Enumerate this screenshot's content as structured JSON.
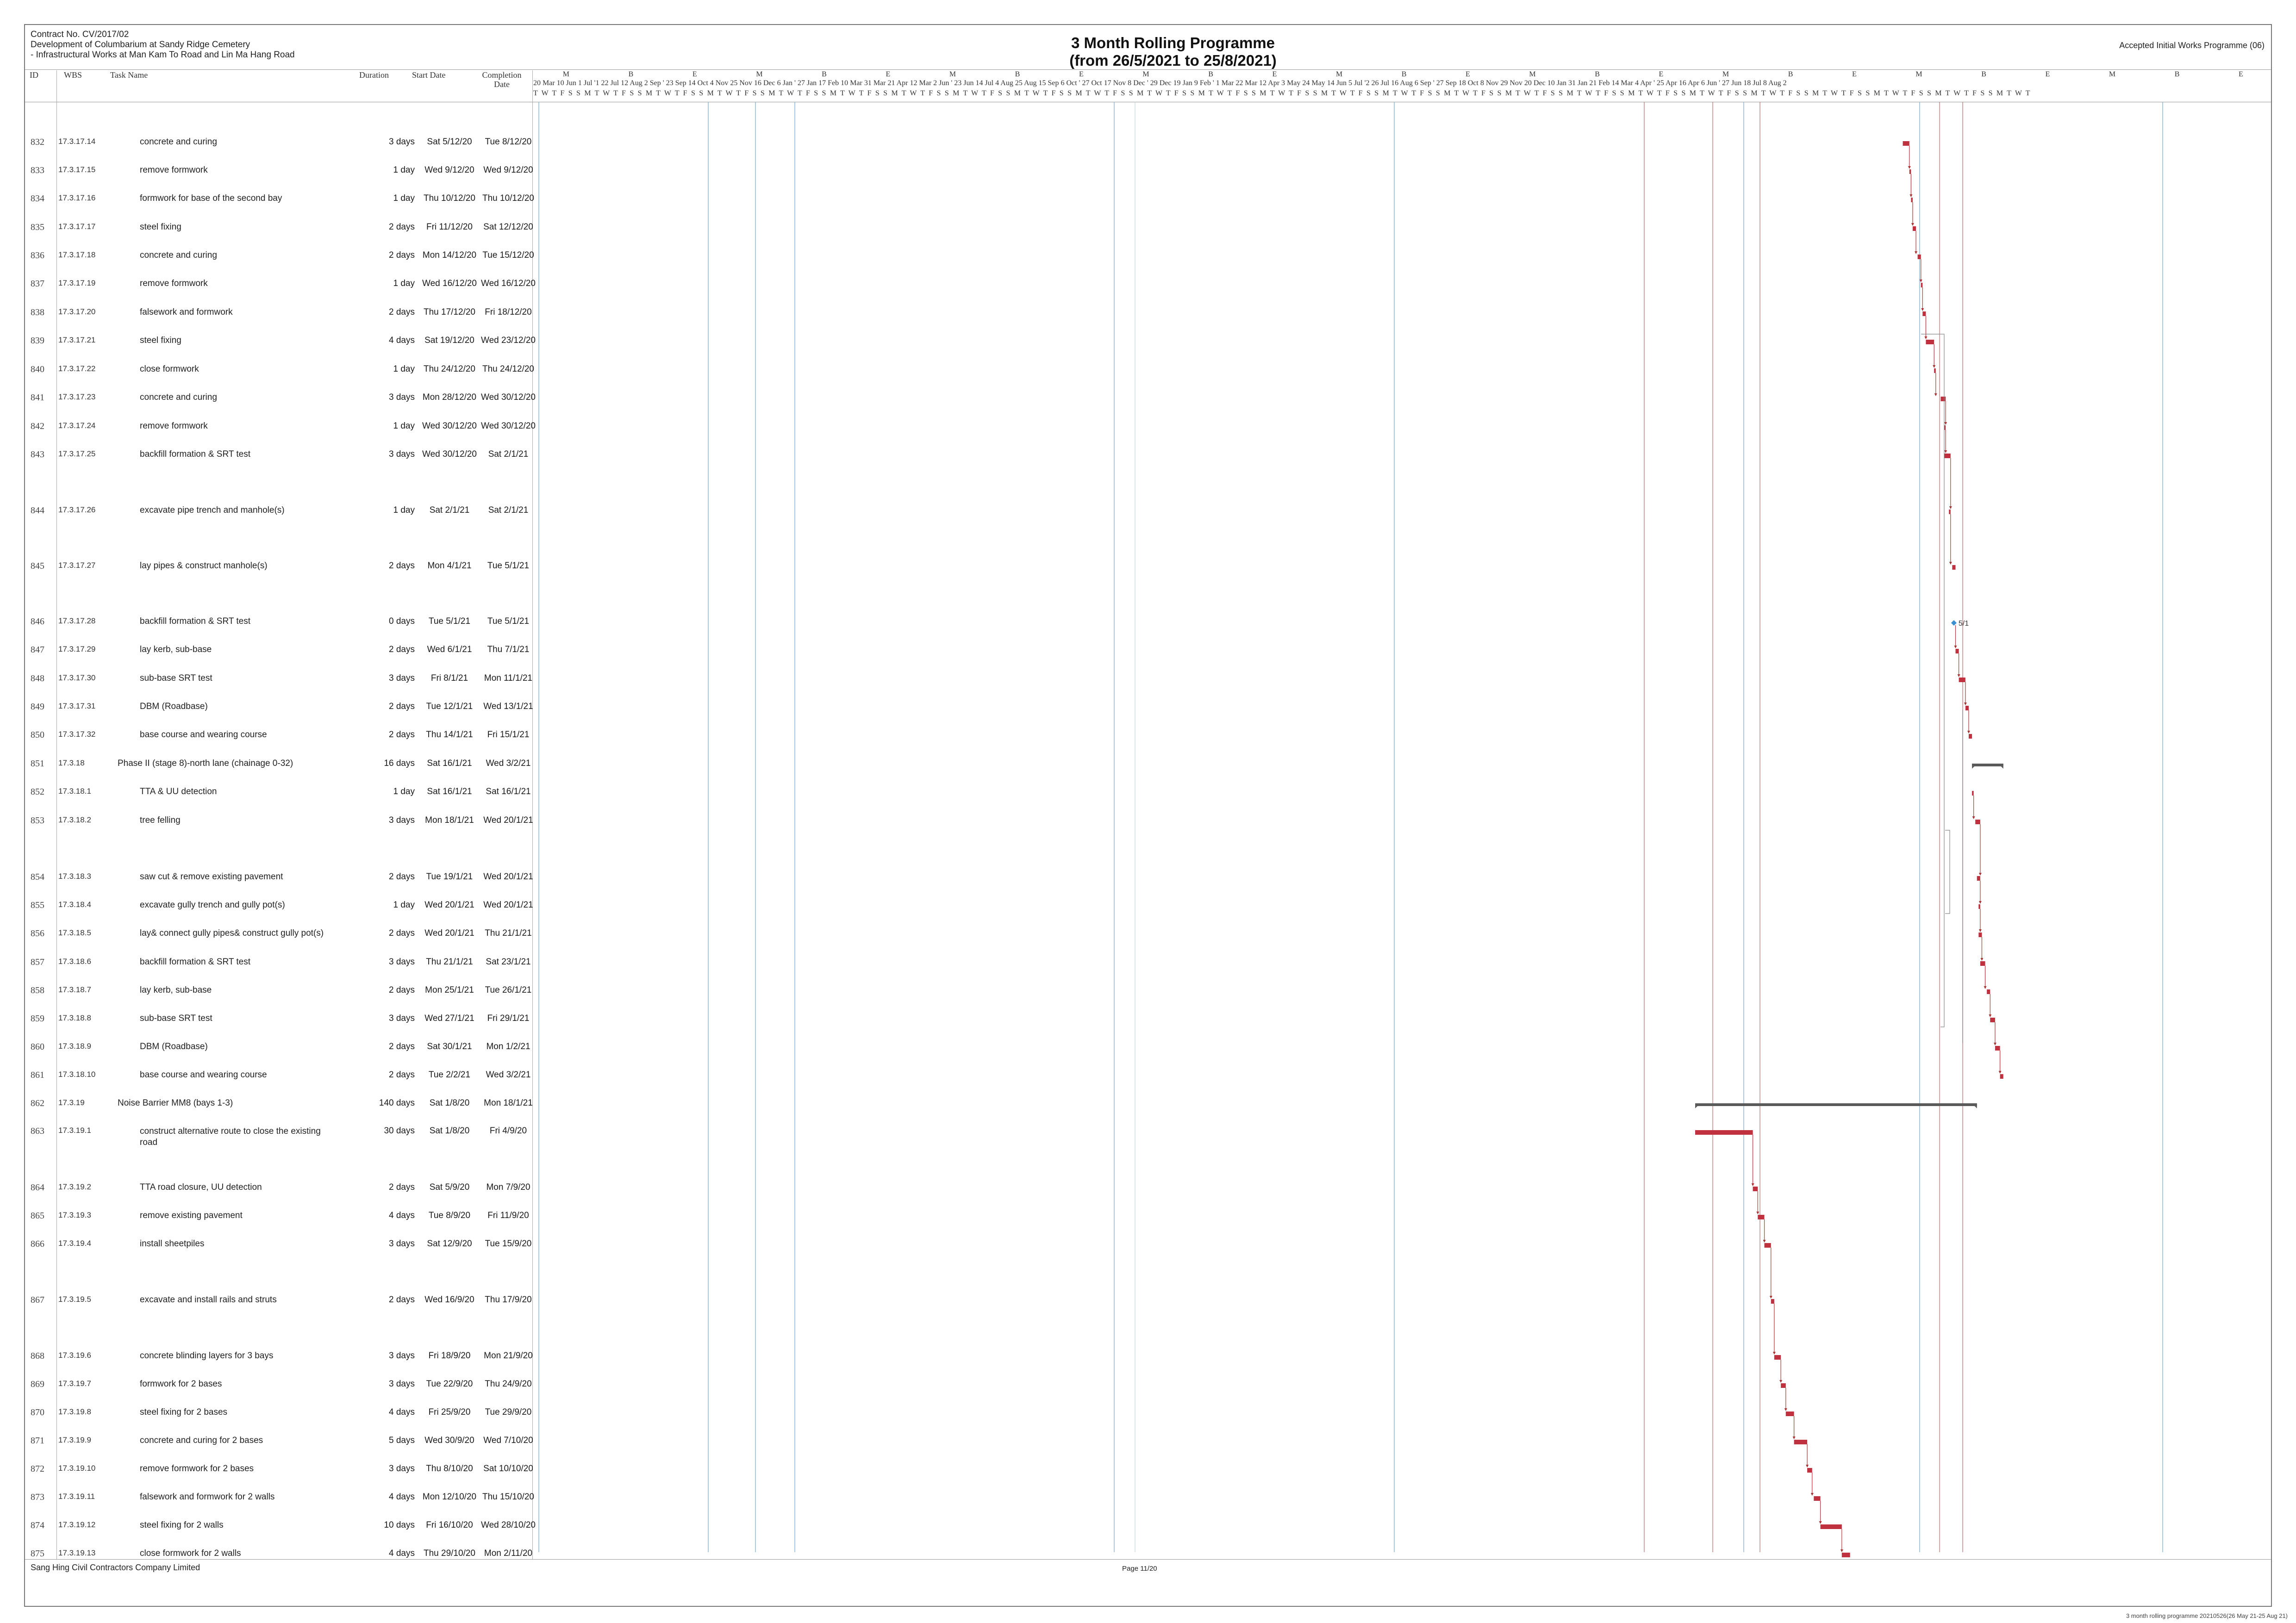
{
  "header": {
    "left_lines": [
      "Contract No. CV/2017/02",
      "Development of Columbarium at Sandy Ridge Cemetery",
      "- Infrastructural Works at Man Kam To Road and Lin Ma Hang Road"
    ],
    "title_line1": "3 Month Rolling Programme",
    "title_line2": "(from 26/5/2021 to 25/8/2021)",
    "right": "Accepted Initial Works Programme (06)"
  },
  "columns": {
    "id": "ID",
    "wbs": "WBS",
    "task": "Task Name",
    "duration": "Duration",
    "start": "Start Date",
    "completion_1": "Completion",
    "completion_2": "Date"
  },
  "timeline": {
    "period_letters": "M B E M B E M B E M B E M B E M B E M B E M B E M B E",
    "dates": "20 Mar 10 Jun 1 Jul '1 22 Jul 12 Aug 2 Sep ' 23 Sep 14 Oct 4 Nov 25 Nov 16 Dec 6 Jan ' 27 Jan 17 Feb 10 Mar 31 Mar 21 Apr 12 Mar 2 Jun ' 23 Jun 14 Jul 4 Aug 25 Aug 15 Sep 6 Oct ' 27 Oct 17 Nov 8 Dec ' 29 Dec 19 Jan 9 Feb ' 1 Mar 22 Mar 12 Apr 3 May 24 May 14 Jun 5 Jul '2 26 Jul 16 Aug 6 Sep ' 27 Sep 18 Oct 8 Nov 29 Nov 20 Dec 10 Jan 31 Jan 21 Feb 14 Mar 4 Apr ' 25 Apr 16 Apr 6 Jun ' 27 Jun 18 Jul 8 Aug 2",
    "days": "T W T F S S M T W T F S S M T W T F S S M T W T F S S M T W T F S S M T W T F S S M T W T F S S M T W T F S S M T W T F S S M T W T F S S M T W T F S S M T W T F S S M T W T F S S M T W T F S S M T W T F S S M T W T F S S M T W T F S S M T W T F S S M T W T F S S M T W T F S S M T W T F S S M T W T F S S M T W T F S S M T W T F S S M T W T"
  },
  "tasks": [
    {
      "id": "832",
      "wbs": "17.3.17.14",
      "name": "concrete and curing",
      "duration": "3 days",
      "start": "Sat 5/12/20",
      "end": "Tue 8/12/20"
    },
    {
      "id": "833",
      "wbs": "17.3.17.15",
      "name": "remove formwork",
      "duration": "1 day",
      "start": "Wed 9/12/20",
      "end": "Wed 9/12/20"
    },
    {
      "id": "834",
      "wbs": "17.3.17.16",
      "name": "formwork for base of the second bay",
      "duration": "1 day",
      "start": "Thu 10/12/20",
      "end": "Thu 10/12/20"
    },
    {
      "id": "835",
      "wbs": "17.3.17.17",
      "name": "steel fixing",
      "duration": "2 days",
      "start": "Fri 11/12/20",
      "end": "Sat 12/12/20"
    },
    {
      "id": "836",
      "wbs": "17.3.17.18",
      "name": "concrete and curing",
      "duration": "2 days",
      "start": "Mon 14/12/20",
      "end": "Tue 15/12/20"
    },
    {
      "id": "837",
      "wbs": "17.3.17.19",
      "name": "remove formwork",
      "duration": "1 day",
      "start": "Wed 16/12/20",
      "end": "Wed 16/12/20"
    },
    {
      "id": "838",
      "wbs": "17.3.17.20",
      "name": "falsework and formwork",
      "duration": "2 days",
      "start": "Thu 17/12/20",
      "end": "Fri 18/12/20"
    },
    {
      "id": "839",
      "wbs": "17.3.17.21",
      "name": "steel fixing",
      "duration": "4 days",
      "start": "Sat 19/12/20",
      "end": "Wed 23/12/20"
    },
    {
      "id": "840",
      "wbs": "17.3.17.22",
      "name": "close formwork",
      "duration": "1 day",
      "start": "Thu 24/12/20",
      "end": "Thu 24/12/20"
    },
    {
      "id": "841",
      "wbs": "17.3.17.23",
      "name": "concrete and curing",
      "duration": "3 days",
      "start": "Mon 28/12/20",
      "end": "Wed 30/12/20"
    },
    {
      "id": "842",
      "wbs": "17.3.17.24",
      "name": "remove formwork",
      "duration": "1 day",
      "start": "Wed 30/12/20",
      "end": "Wed 30/12/20"
    },
    {
      "id": "843",
      "wbs": "17.3.17.25",
      "name": "backfill formation & SRT test",
      "duration": "3 days",
      "start": "Wed 30/12/20",
      "end": "Sat 2/1/21"
    },
    {
      "id": "844",
      "wbs": "17.3.17.26",
      "name": "excavate pipe trench and manhole(s)",
      "duration": "1 day",
      "start": "Sat 2/1/21",
      "end": "Sat 2/1/21"
    },
    {
      "id": "845",
      "wbs": "17.3.17.27",
      "name": "lay pipes & construct manhole(s)",
      "duration": "2 days",
      "start": "Mon 4/1/21",
      "end": "Tue 5/1/21"
    },
    {
      "id": "846",
      "wbs": "17.3.17.28",
      "name": "backfill formation & SRT test",
      "duration": "0 days",
      "start": "Tue 5/1/21",
      "end": "Tue 5/1/21"
    },
    {
      "id": "847",
      "wbs": "17.3.17.29",
      "name": "lay kerb, sub-base",
      "duration": "2 days",
      "start": "Wed 6/1/21",
      "end": "Thu 7/1/21"
    },
    {
      "id": "848",
      "wbs": "17.3.17.30",
      "name": "sub-base SRT test",
      "duration": "3 days",
      "start": "Fri 8/1/21",
      "end": "Mon 11/1/21"
    },
    {
      "id": "849",
      "wbs": "17.3.17.31",
      "name": "DBM (Roadbase)",
      "duration": "2 days",
      "start": "Tue 12/1/21",
      "end": "Wed 13/1/21"
    },
    {
      "id": "850",
      "wbs": "17.3.17.32",
      "name": "base course and wearing course",
      "duration": "2 days",
      "start": "Thu 14/1/21",
      "end": "Fri 15/1/21"
    },
    {
      "id": "851",
      "wbs": "17.3.18",
      "name": "Phase II (stage 8)-north lane (chainage 0-32)",
      "duration": "16 days",
      "start": "Sat 16/1/21",
      "end": "Wed 3/2/21"
    },
    {
      "id": "852",
      "wbs": "17.3.18.1",
      "name": "TTA & UU detection",
      "duration": "1 day",
      "start": "Sat 16/1/21",
      "end": "Sat 16/1/21"
    },
    {
      "id": "853",
      "wbs": "17.3.18.2",
      "name": "tree felling",
      "duration": "3 days",
      "start": "Mon 18/1/21",
      "end": "Wed 20/1/21"
    },
    {
      "id": "854",
      "wbs": "17.3.18.3",
      "name": "saw cut & remove existing pavement",
      "duration": "2 days",
      "start": "Tue 19/1/21",
      "end": "Wed 20/1/21"
    },
    {
      "id": "855",
      "wbs": "17.3.18.4",
      "name": "excavate gully trench and gully pot(s)",
      "duration": "1 day",
      "start": "Wed 20/1/21",
      "end": "Wed 20/1/21"
    },
    {
      "id": "856",
      "wbs": "17.3.18.5",
      "name": "lay& connect gully pipes& construct gully pot(s)",
      "duration": "2 days",
      "start": "Wed 20/1/21",
      "end": "Thu 21/1/21"
    },
    {
      "id": "857",
      "wbs": "17.3.18.6",
      "name": "backfill formation & SRT test",
      "duration": "3 days",
      "start": "Thu 21/1/21",
      "end": "Sat 23/1/21"
    },
    {
      "id": "858",
      "wbs": "17.3.18.7",
      "name": "lay kerb, sub-base",
      "duration": "2 days",
      "start": "Mon 25/1/21",
      "end": "Tue 26/1/21"
    },
    {
      "id": "859",
      "wbs": "17.3.18.8",
      "name": "sub-base SRT test",
      "duration": "3 days",
      "start": "Wed 27/1/21",
      "end": "Fri 29/1/21"
    },
    {
      "id": "860",
      "wbs": "17.3.18.9",
      "name": "DBM (Roadbase)",
      "duration": "2 days",
      "start": "Sat 30/1/21",
      "end": "Mon 1/2/21"
    },
    {
      "id": "861",
      "wbs": "17.3.18.10",
      "name": "base course and wearing course",
      "duration": "2 days",
      "start": "Tue 2/2/21",
      "end": "Wed 3/2/21"
    },
    {
      "id": "862",
      "wbs": "17.3.19",
      "name": "Noise Barrier MM8 (bays 1-3)",
      "duration": "140 days",
      "start": "Sat 1/8/20",
      "end": "Mon 18/1/21"
    },
    {
      "id": "863",
      "wbs": "17.3.19.1",
      "name": "construct alternative route to close the existing road",
      "duration": "30 days",
      "start": "Sat 1/8/20",
      "end": "Fri 4/9/20"
    },
    {
      "id": "864",
      "wbs": "17.3.19.2",
      "name": "TTA road closure, UU detection",
      "duration": "2 days",
      "start": "Sat 5/9/20",
      "end": "Mon 7/9/20"
    },
    {
      "id": "865",
      "wbs": "17.3.19.3",
      "name": "remove existing pavement",
      "duration": "4 days",
      "start": "Tue 8/9/20",
      "end": "Fri 11/9/20"
    },
    {
      "id": "866",
      "wbs": "17.3.19.4",
      "name": "install sheetpiles",
      "duration": "3 days",
      "start": "Sat 12/9/20",
      "end": "Tue 15/9/20"
    },
    {
      "id": "867",
      "wbs": "17.3.19.5",
      "name": "excavate and install rails and struts",
      "duration": "2 days",
      "start": "Wed 16/9/20",
      "end": "Thu 17/9/20"
    },
    {
      "id": "868",
      "wbs": "17.3.19.6",
      "name": "concrete blinding layers for 3 bays",
      "duration": "3 days",
      "start": "Fri 18/9/20",
      "end": "Mon 21/9/20"
    },
    {
      "id": "869",
      "wbs": "17.3.19.7",
      "name": "formwork for 2 bases",
      "duration": "3 days",
      "start": "Tue 22/9/20",
      "end": "Thu 24/9/20"
    },
    {
      "id": "870",
      "wbs": "17.3.19.8",
      "name": "steel fixing for 2 bases",
      "duration": "4 days",
      "start": "Fri 25/9/20",
      "end": "Tue 29/9/20"
    },
    {
      "id": "871",
      "wbs": "17.3.19.9",
      "name": "concrete and curing for 2 bases",
      "duration": "5 days",
      "start": "Wed 30/9/20",
      "end": "Wed 7/10/20"
    },
    {
      "id": "872",
      "wbs": "17.3.19.10",
      "name": "remove formwork for 2 bases",
      "duration": "3 days",
      "start": "Thu 8/10/20",
      "end": "Sat 10/10/20"
    },
    {
      "id": "873",
      "wbs": "17.3.19.11",
      "name": "falsework and formwork for 2 walls",
      "duration": "4 days",
      "start": "Mon 12/10/20",
      "end": "Thu 15/10/20"
    },
    {
      "id": "874",
      "wbs": "17.3.19.12",
      "name": "steel fixing for 2 walls",
      "duration": "10 days",
      "start": "Fri 16/10/20",
      "end": "Wed 28/10/20"
    },
    {
      "id": "875",
      "wbs": "17.3.19.13",
      "name": "close formwork for 2 walls",
      "duration": "4 days",
      "start": "Thu 29/10/20",
      "end": "Mon 2/11/20"
    }
  ],
  "milestone_label": "5/1",
  "colors": {
    "bar": "#c0313f",
    "summary": "#5a5a5a",
    "link": "#a33",
    "milestone": "#3a8fd0",
    "vline_blue": "#8fb8d8",
    "vline_red": "#c98a8a"
  },
  "footer": {
    "left": "Sang Hing Civil Contractors Company Limited",
    "page": "Page 11/20",
    "right": "3 month rolling programme 20210526(26 May 21-25 Aug 21)"
  }
}
